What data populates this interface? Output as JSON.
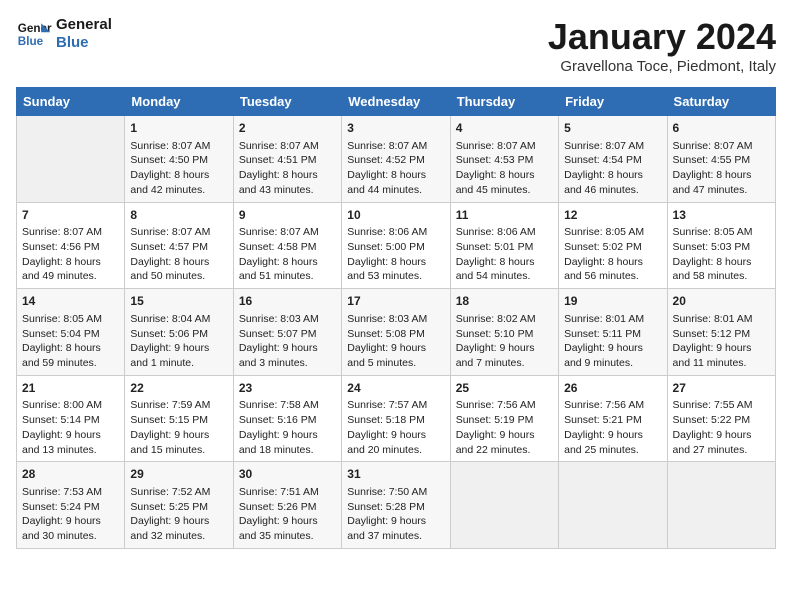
{
  "logo": {
    "line1": "General",
    "line2": "Blue"
  },
  "title": "January 2024",
  "location": "Gravellona Toce, Piedmont, Italy",
  "weekdays": [
    "Sunday",
    "Monday",
    "Tuesday",
    "Wednesday",
    "Thursday",
    "Friday",
    "Saturday"
  ],
  "weeks": [
    [
      {
        "day": "",
        "info": ""
      },
      {
        "day": "1",
        "info": "Sunrise: 8:07 AM\nSunset: 4:50 PM\nDaylight: 8 hours\nand 42 minutes."
      },
      {
        "day": "2",
        "info": "Sunrise: 8:07 AM\nSunset: 4:51 PM\nDaylight: 8 hours\nand 43 minutes."
      },
      {
        "day": "3",
        "info": "Sunrise: 8:07 AM\nSunset: 4:52 PM\nDaylight: 8 hours\nand 44 minutes."
      },
      {
        "day": "4",
        "info": "Sunrise: 8:07 AM\nSunset: 4:53 PM\nDaylight: 8 hours\nand 45 minutes."
      },
      {
        "day": "5",
        "info": "Sunrise: 8:07 AM\nSunset: 4:54 PM\nDaylight: 8 hours\nand 46 minutes."
      },
      {
        "day": "6",
        "info": "Sunrise: 8:07 AM\nSunset: 4:55 PM\nDaylight: 8 hours\nand 47 minutes."
      }
    ],
    [
      {
        "day": "7",
        "info": "Sunrise: 8:07 AM\nSunset: 4:56 PM\nDaylight: 8 hours\nand 49 minutes."
      },
      {
        "day": "8",
        "info": "Sunrise: 8:07 AM\nSunset: 4:57 PM\nDaylight: 8 hours\nand 50 minutes."
      },
      {
        "day": "9",
        "info": "Sunrise: 8:07 AM\nSunset: 4:58 PM\nDaylight: 8 hours\nand 51 minutes."
      },
      {
        "day": "10",
        "info": "Sunrise: 8:06 AM\nSunset: 5:00 PM\nDaylight: 8 hours\nand 53 minutes."
      },
      {
        "day": "11",
        "info": "Sunrise: 8:06 AM\nSunset: 5:01 PM\nDaylight: 8 hours\nand 54 minutes."
      },
      {
        "day": "12",
        "info": "Sunrise: 8:05 AM\nSunset: 5:02 PM\nDaylight: 8 hours\nand 56 minutes."
      },
      {
        "day": "13",
        "info": "Sunrise: 8:05 AM\nSunset: 5:03 PM\nDaylight: 8 hours\nand 58 minutes."
      }
    ],
    [
      {
        "day": "14",
        "info": "Sunrise: 8:05 AM\nSunset: 5:04 PM\nDaylight: 8 hours\nand 59 minutes."
      },
      {
        "day": "15",
        "info": "Sunrise: 8:04 AM\nSunset: 5:06 PM\nDaylight: 9 hours\nand 1 minute."
      },
      {
        "day": "16",
        "info": "Sunrise: 8:03 AM\nSunset: 5:07 PM\nDaylight: 9 hours\nand 3 minutes."
      },
      {
        "day": "17",
        "info": "Sunrise: 8:03 AM\nSunset: 5:08 PM\nDaylight: 9 hours\nand 5 minutes."
      },
      {
        "day": "18",
        "info": "Sunrise: 8:02 AM\nSunset: 5:10 PM\nDaylight: 9 hours\nand 7 minutes."
      },
      {
        "day": "19",
        "info": "Sunrise: 8:01 AM\nSunset: 5:11 PM\nDaylight: 9 hours\nand 9 minutes."
      },
      {
        "day": "20",
        "info": "Sunrise: 8:01 AM\nSunset: 5:12 PM\nDaylight: 9 hours\nand 11 minutes."
      }
    ],
    [
      {
        "day": "21",
        "info": "Sunrise: 8:00 AM\nSunset: 5:14 PM\nDaylight: 9 hours\nand 13 minutes."
      },
      {
        "day": "22",
        "info": "Sunrise: 7:59 AM\nSunset: 5:15 PM\nDaylight: 9 hours\nand 15 minutes."
      },
      {
        "day": "23",
        "info": "Sunrise: 7:58 AM\nSunset: 5:16 PM\nDaylight: 9 hours\nand 18 minutes."
      },
      {
        "day": "24",
        "info": "Sunrise: 7:57 AM\nSunset: 5:18 PM\nDaylight: 9 hours\nand 20 minutes."
      },
      {
        "day": "25",
        "info": "Sunrise: 7:56 AM\nSunset: 5:19 PM\nDaylight: 9 hours\nand 22 minutes."
      },
      {
        "day": "26",
        "info": "Sunrise: 7:56 AM\nSunset: 5:21 PM\nDaylight: 9 hours\nand 25 minutes."
      },
      {
        "day": "27",
        "info": "Sunrise: 7:55 AM\nSunset: 5:22 PM\nDaylight: 9 hours\nand 27 minutes."
      }
    ],
    [
      {
        "day": "28",
        "info": "Sunrise: 7:53 AM\nSunset: 5:24 PM\nDaylight: 9 hours\nand 30 minutes."
      },
      {
        "day": "29",
        "info": "Sunrise: 7:52 AM\nSunset: 5:25 PM\nDaylight: 9 hours\nand 32 minutes."
      },
      {
        "day": "30",
        "info": "Sunrise: 7:51 AM\nSunset: 5:26 PM\nDaylight: 9 hours\nand 35 minutes."
      },
      {
        "day": "31",
        "info": "Sunrise: 7:50 AM\nSunset: 5:28 PM\nDaylight: 9 hours\nand 37 minutes."
      },
      {
        "day": "",
        "info": ""
      },
      {
        "day": "",
        "info": ""
      },
      {
        "day": "",
        "info": ""
      }
    ]
  ]
}
